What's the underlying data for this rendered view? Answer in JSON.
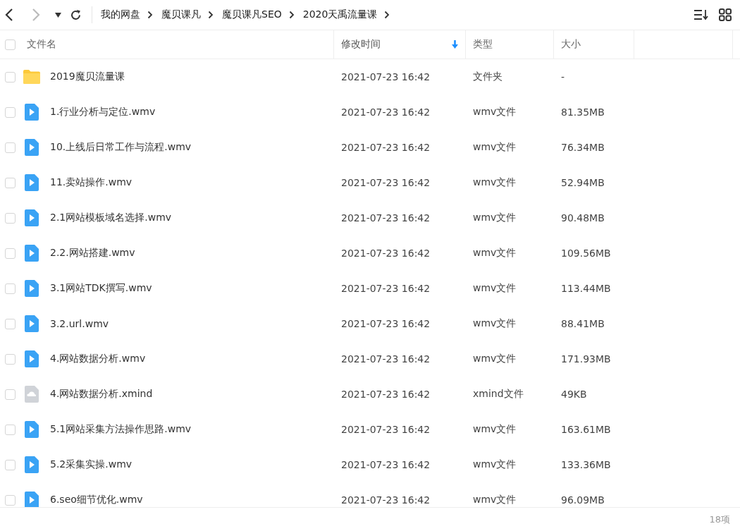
{
  "breadcrumb": [
    "我的网盘",
    "魔贝课凡",
    "魔贝课凡SEO",
    "2020天禹流量课"
  ],
  "select_all": {
    "checked": false
  },
  "columns": [
    {
      "label": "文件名",
      "sorted": false
    },
    {
      "label": "修改时间",
      "sorted": true
    },
    {
      "label": "类型",
      "sorted": false
    },
    {
      "label": "大小",
      "sorted": false
    }
  ],
  "rows": [
    {
      "kind": "folder",
      "name": "2019魔贝流量课",
      "modified": "2021-07-23 16:42",
      "type": "文件夹",
      "size": "-",
      "checked": false
    },
    {
      "kind": "video",
      "name": "1.行业分析与定位.wmv",
      "modified": "2021-07-23 16:42",
      "type": "wmv文件",
      "size": "81.35MB",
      "checked": false
    },
    {
      "kind": "video",
      "name": "10.上线后日常工作与流程.wmv",
      "modified": "2021-07-23 16:42",
      "type": "wmv文件",
      "size": "76.34MB",
      "checked": false
    },
    {
      "kind": "video",
      "name": "11.卖站操作.wmv",
      "modified": "2021-07-23 16:42",
      "type": "wmv文件",
      "size": "52.94MB",
      "checked": false
    },
    {
      "kind": "video",
      "name": "2.1网站模板域名选择.wmv",
      "modified": "2021-07-23 16:42",
      "type": "wmv文件",
      "size": "90.48MB",
      "checked": false
    },
    {
      "kind": "video",
      "name": "2.2.网站搭建.wmv",
      "modified": "2021-07-23 16:42",
      "type": "wmv文件",
      "size": "109.56MB",
      "checked": false
    },
    {
      "kind": "video",
      "name": "3.1网站TDK撰写.wmv",
      "modified": "2021-07-23 16:42",
      "type": "wmv文件",
      "size": "113.44MB",
      "checked": false
    },
    {
      "kind": "video",
      "name": "3.2.url.wmv",
      "modified": "2021-07-23 16:42",
      "type": "wmv文件",
      "size": "88.41MB",
      "checked": false
    },
    {
      "kind": "video",
      "name": "4.网站数据分析.wmv",
      "modified": "2021-07-23 16:42",
      "type": "wmv文件",
      "size": "171.93MB",
      "checked": false
    },
    {
      "kind": "xmind",
      "name": "4.网站数据分析.xmind",
      "modified": "2021-07-23 16:42",
      "type": "xmind文件",
      "size": "49KB",
      "checked": false
    },
    {
      "kind": "video",
      "name": "5.1网站采集方法操作思路.wmv",
      "modified": "2021-07-23 16:42",
      "type": "wmv文件",
      "size": "163.61MB",
      "checked": false
    },
    {
      "kind": "video",
      "name": "5.2采集实操.wmv",
      "modified": "2021-07-23 16:42",
      "type": "wmv文件",
      "size": "133.36MB",
      "checked": false
    },
    {
      "kind": "video",
      "name": "6.seo细节优化.wmv",
      "modified": "2021-07-23 16:42",
      "type": "wmv文件",
      "size": "96.09MB",
      "checked": false
    }
  ],
  "status_bar": {
    "count": "18项"
  }
}
